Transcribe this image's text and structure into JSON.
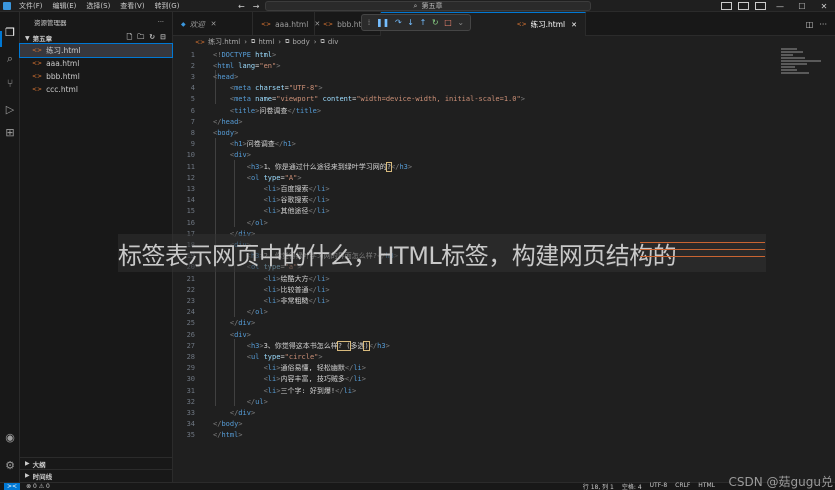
{
  "menu": [
    "文件(F)",
    "编辑(E)",
    "选择(S)",
    "查看(V)",
    "转到(G)"
  ],
  "nav": {
    "back": "←",
    "forward": "→"
  },
  "search": {
    "icon": "search-icon",
    "text": "第五章"
  },
  "sidebar": {
    "title": "资源管理器",
    "more": "···",
    "folder": "第五章",
    "files": [
      "练习.html",
      "aaa.html",
      "bbb.html",
      "ccc.html"
    ],
    "active_file": 0,
    "outline": "大纲",
    "timeline": "时间线"
  },
  "tabs": [
    {
      "label": "欢迎",
      "type": "welcome"
    },
    {
      "label": "aaa.html",
      "type": "html"
    },
    {
      "label": "bbb.html",
      "type": "html"
    },
    {
      "label": "练习.html",
      "type": "html",
      "active": true
    }
  ],
  "breadcrumb": [
    "练习.html",
    "html",
    "body",
    "div"
  ],
  "code_lines": [
    [
      [
        "c-br",
        "<!"
      ],
      [
        "c-doc",
        "DOCTYPE"
      ],
      [
        "c-attr",
        " html"
      ],
      [
        "c-br",
        ">"
      ]
    ],
    [
      [
        "c-br",
        "<"
      ],
      [
        "c-tag",
        "html"
      ],
      [
        "c-attr",
        " lang"
      ],
      [
        "c-txt",
        "="
      ],
      [
        "c-str",
        "\"en\""
      ],
      [
        "c-br",
        ">"
      ]
    ],
    [
      [
        "c-br",
        "<"
      ],
      [
        "c-tag",
        "head"
      ],
      [
        "c-br",
        ">"
      ]
    ],
    [
      [
        "c-txt",
        "    "
      ],
      [
        "c-br",
        "<"
      ],
      [
        "c-tag",
        "meta"
      ],
      [
        "c-attr",
        " charset"
      ],
      [
        "c-txt",
        "="
      ],
      [
        "c-str",
        "\"UTF-8\""
      ],
      [
        "c-br",
        ">"
      ]
    ],
    [
      [
        "c-txt",
        "    "
      ],
      [
        "c-br",
        "<"
      ],
      [
        "c-tag",
        "meta"
      ],
      [
        "c-attr",
        " name"
      ],
      [
        "c-txt",
        "="
      ],
      [
        "c-str",
        "\"viewport\""
      ],
      [
        "c-attr",
        " content"
      ],
      [
        "c-txt",
        "="
      ],
      [
        "c-str",
        "\"width=device-width, initial-scale=1.0\""
      ],
      [
        "c-br",
        ">"
      ]
    ],
    [
      [
        "c-txt",
        "    "
      ],
      [
        "c-br",
        "<"
      ],
      [
        "c-tag",
        "title"
      ],
      [
        "c-br",
        ">"
      ],
      [
        "c-txt",
        "问卷调查"
      ],
      [
        "c-br",
        "</"
      ],
      [
        "c-tag",
        "title"
      ],
      [
        "c-br",
        ">"
      ]
    ],
    [
      [
        "c-br",
        "</"
      ],
      [
        "c-tag",
        "head"
      ],
      [
        "c-br",
        ">"
      ]
    ],
    [
      [
        "c-br",
        "<"
      ],
      [
        "c-tag",
        "body"
      ],
      [
        "c-br",
        ">"
      ]
    ],
    [
      [
        "c-txt",
        "    "
      ],
      [
        "c-br",
        "<"
      ],
      [
        "c-tag",
        "h1"
      ],
      [
        "c-br",
        ">"
      ],
      [
        "c-txt",
        "问卷调查"
      ],
      [
        "c-br",
        "</"
      ],
      [
        "c-tag",
        "h1"
      ],
      [
        "c-br",
        ">"
      ]
    ],
    [
      [
        "c-txt",
        "    "
      ],
      [
        "c-br",
        "<"
      ],
      [
        "c-tag",
        "div"
      ],
      [
        "c-br",
        ">"
      ]
    ],
    [
      [
        "c-txt",
        "        "
      ],
      [
        "c-br",
        "<"
      ],
      [
        "c-tag",
        "h3"
      ],
      [
        "c-br",
        ">"
      ],
      [
        "c-txt",
        "1、你是通过什么途径来到绿叶学习网的"
      ],
      [
        "selbox",
        "?"
      ],
      [
        "c-br",
        "</"
      ],
      [
        "c-tag",
        "h3"
      ],
      [
        "c-br",
        ">"
      ]
    ],
    [
      [
        "c-txt",
        "        "
      ],
      [
        "c-br",
        "<"
      ],
      [
        "c-tag",
        "ol"
      ],
      [
        "c-attr",
        " type"
      ],
      [
        "c-txt",
        "="
      ],
      [
        "c-str",
        "\"A\""
      ],
      [
        "c-br",
        ">"
      ]
    ],
    [
      [
        "c-txt",
        "            "
      ],
      [
        "c-br",
        "<"
      ],
      [
        "c-tag",
        "li"
      ],
      [
        "c-br",
        ">"
      ],
      [
        "c-txt",
        "百度搜索"
      ],
      [
        "c-br",
        "</"
      ],
      [
        "c-tag",
        "li"
      ],
      [
        "c-br",
        ">"
      ]
    ],
    [
      [
        "c-txt",
        "            "
      ],
      [
        "c-br",
        "<"
      ],
      [
        "c-tag",
        "li"
      ],
      [
        "c-br",
        ">"
      ],
      [
        "c-txt",
        "谷歌搜索"
      ],
      [
        "c-br",
        "</"
      ],
      [
        "c-tag",
        "li"
      ],
      [
        "c-br",
        ">"
      ]
    ],
    [
      [
        "c-txt",
        "            "
      ],
      [
        "c-br",
        "<"
      ],
      [
        "c-tag",
        "li"
      ],
      [
        "c-br",
        ">"
      ],
      [
        "c-txt",
        "其他途径"
      ],
      [
        "c-br",
        "</"
      ],
      [
        "c-tag",
        "li"
      ],
      [
        "c-br",
        ">"
      ]
    ],
    [
      [
        "c-txt",
        "        "
      ],
      [
        "c-br",
        "</"
      ],
      [
        "c-tag",
        "ol"
      ],
      [
        "c-br",
        ">"
      ]
    ],
    [
      [
        "c-txt",
        "    "
      ],
      [
        "c-br",
        "</"
      ],
      [
        "c-tag",
        "div"
      ],
      [
        "c-br",
        ">"
      ]
    ],
    [
      [
        "c-txt",
        "    "
      ],
      [
        "c-br",
        "<"
      ],
      [
        "c-tag",
        "div"
      ],
      [
        "c-br",
        ">"
      ]
    ],
    [
      [
        "c-txt",
        "        "
      ],
      [
        "c-br",
        "<"
      ],
      [
        "c-tag",
        "h3"
      ],
      [
        "c-br",
        ">"
      ],
      [
        "c-txt",
        "2、你觉得绿叶学习网的界面怎么样?"
      ],
      [
        "c-br",
        "</"
      ],
      [
        "c-tag",
        "h3"
      ],
      [
        "c-br",
        ">"
      ]
    ],
    [
      [
        "c-txt",
        "        "
      ],
      [
        "c-br",
        "<"
      ],
      [
        "c-tag",
        "ol"
      ],
      [
        "c-attr",
        " type"
      ],
      [
        "c-txt",
        "="
      ],
      [
        "c-str",
        "\"a\""
      ],
      [
        "c-br",
        ">"
      ]
    ],
    [
      [
        "c-txt",
        "            "
      ],
      [
        "c-br",
        "<"
      ],
      [
        "c-tag",
        "li"
      ],
      [
        "c-br",
        ">"
      ],
      [
        "c-txt",
        "绘酷大方"
      ],
      [
        "c-br",
        "</"
      ],
      [
        "c-tag",
        "li"
      ],
      [
        "c-br",
        ">"
      ]
    ],
    [
      [
        "c-txt",
        "            "
      ],
      [
        "c-br",
        "<"
      ],
      [
        "c-tag",
        "li"
      ],
      [
        "c-br",
        ">"
      ],
      [
        "c-txt",
        "比较普通"
      ],
      [
        "c-br",
        "</"
      ],
      [
        "c-tag",
        "li"
      ],
      [
        "c-br",
        ">"
      ]
    ],
    [
      [
        "c-txt",
        "            "
      ],
      [
        "c-br",
        "<"
      ],
      [
        "c-tag",
        "li"
      ],
      [
        "c-br",
        ">"
      ],
      [
        "c-txt",
        "非常粗糙"
      ],
      [
        "c-br",
        "</"
      ],
      [
        "c-tag",
        "li"
      ],
      [
        "c-br",
        ">"
      ]
    ],
    [
      [
        "c-txt",
        "        "
      ],
      [
        "c-br",
        "</"
      ],
      [
        "c-tag",
        "ol"
      ],
      [
        "c-br",
        ">"
      ]
    ],
    [
      [
        "c-txt",
        "    "
      ],
      [
        "c-br",
        "</"
      ],
      [
        "c-tag",
        "div"
      ],
      [
        "c-br",
        ">"
      ]
    ],
    [
      [
        "c-txt",
        "    "
      ],
      [
        "c-br",
        "<"
      ],
      [
        "c-tag",
        "div"
      ],
      [
        "c-br",
        ">"
      ]
    ],
    [
      [
        "c-txt",
        "        "
      ],
      [
        "c-br",
        "<"
      ],
      [
        "c-tag",
        "h3"
      ],
      [
        "c-br",
        ">"
      ],
      [
        "c-txt",
        "3、你觉得这本书怎么样"
      ],
      [
        "selbox",
        "? ("
      ],
      [
        "c-txt",
        "多选"
      ],
      [
        "selbox",
        ")"
      ],
      [
        "c-br",
        "</"
      ],
      [
        "c-tag",
        "h3"
      ],
      [
        "c-br",
        ">"
      ]
    ],
    [
      [
        "c-txt",
        "        "
      ],
      [
        "c-br",
        "<"
      ],
      [
        "c-tag",
        "ul"
      ],
      [
        "c-attr",
        " type"
      ],
      [
        "c-txt",
        "="
      ],
      [
        "c-str",
        "\"circle\""
      ],
      [
        "c-br",
        ">"
      ]
    ],
    [
      [
        "c-txt",
        "            "
      ],
      [
        "c-br",
        "<"
      ],
      [
        "c-tag",
        "li"
      ],
      [
        "c-br",
        ">"
      ],
      [
        "c-txt",
        "通俗易懂, 轻松幽默"
      ],
      [
        "c-br",
        "</"
      ],
      [
        "c-tag",
        "li"
      ],
      [
        "c-br",
        ">"
      ]
    ],
    [
      [
        "c-txt",
        "            "
      ],
      [
        "c-br",
        "<"
      ],
      [
        "c-tag",
        "li"
      ],
      [
        "c-br",
        ">"
      ],
      [
        "c-txt",
        "内容丰富, 技巧贼多"
      ],
      [
        "c-br",
        "</"
      ],
      [
        "c-tag",
        "li"
      ],
      [
        "c-br",
        ">"
      ]
    ],
    [
      [
        "c-txt",
        "            "
      ],
      [
        "c-br",
        "<"
      ],
      [
        "c-tag",
        "li"
      ],
      [
        "c-br",
        ">"
      ],
      [
        "c-txt",
        "三个字: 好到爆!"
      ],
      [
        "c-br",
        "</"
      ],
      [
        "c-tag",
        "li"
      ],
      [
        "c-br",
        ">"
      ]
    ],
    [
      [
        "c-txt",
        "        "
      ],
      [
        "c-br",
        "</"
      ],
      [
        "c-tag",
        "ul"
      ],
      [
        "c-br",
        ">"
      ]
    ],
    [
      [
        "c-txt",
        "    "
      ],
      [
        "c-br",
        "</"
      ],
      [
        "c-tag",
        "div"
      ],
      [
        "c-br",
        ">"
      ]
    ],
    [
      [
        "c-br",
        "</"
      ],
      [
        "c-tag",
        "body"
      ],
      [
        "c-br",
        ">"
      ]
    ],
    [
      [
        "c-br",
        "</"
      ],
      [
        "c-tag",
        "html"
      ],
      [
        "c-br",
        ">"
      ]
    ]
  ],
  "banner": "标签表示网页中的什么，HTML标签，构建网页结构的",
  "status": {
    "remote": "⊗ 0 ⚠ 0",
    "right": [
      "行 18, 列 1",
      "空格: 4",
      "UTF-8",
      "CRLF",
      "HTML"
    ]
  },
  "watermark": "CSDN @菇gugu兑"
}
